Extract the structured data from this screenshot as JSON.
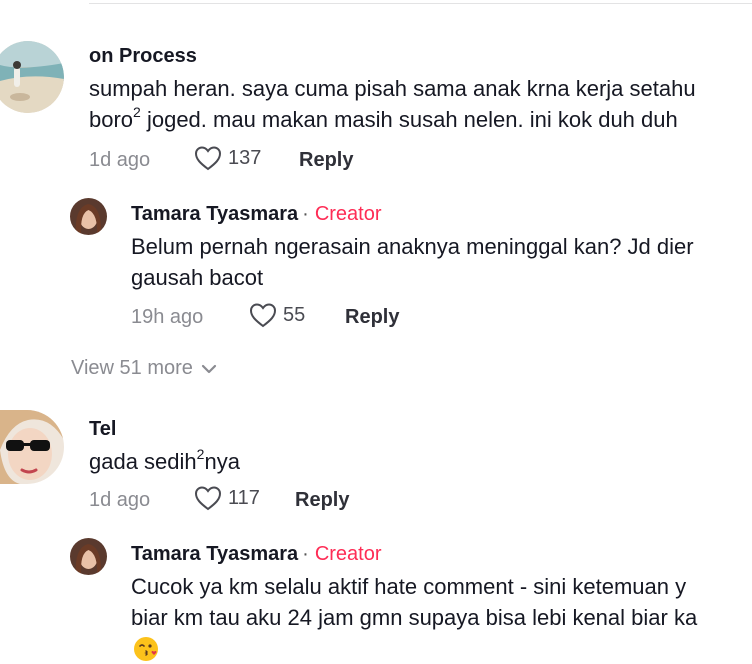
{
  "comments": [
    {
      "username": "on Process",
      "line1": "sumpah heran. saya cuma pisah sama anak krna kerja setahu",
      "line2_pre": "boro",
      "line2_sup": "2",
      "line2_post": " joged. mau makan masih susah nelen. ini kok duh duh",
      "time": "1d ago",
      "likes": "137",
      "reply": "Reply"
    },
    {
      "username": "Tel",
      "line1_pre": "gada sedih",
      "line1_sup": "2",
      "line1_post": "nya",
      "time": "1d ago",
      "likes": "117",
      "reply": "Reply"
    }
  ],
  "replies": [
    {
      "username": "Tamara Tyasmara",
      "separator": "·",
      "badge": "Creator",
      "line1": "Belum pernah ngerasain anaknya meninggal kan? Jd dier",
      "line2": "gausah bacot",
      "time": "19h ago",
      "likes": "55",
      "reply": "Reply"
    },
    {
      "username": "Tamara Tyasmara",
      "separator": "·",
      "badge": "Creator",
      "line1": "Cucok ya km selalu aktif hate comment - sini ketemuan y",
      "line2": "biar km tau aku 24 jam gmn supaya bisa lebi kenal biar ka",
      "emoji": "face-blowing-kiss-emoji",
      "time": "",
      "likes": "",
      "reply": ""
    }
  ],
  "view_more": "View 51 more",
  "icons": {
    "like": "heart-outline-icon",
    "expand": "chevron-down-icon"
  },
  "colors": {
    "creator": "#fe2c55",
    "secondary_text": "#8a8b91",
    "primary_text": "#161823"
  }
}
